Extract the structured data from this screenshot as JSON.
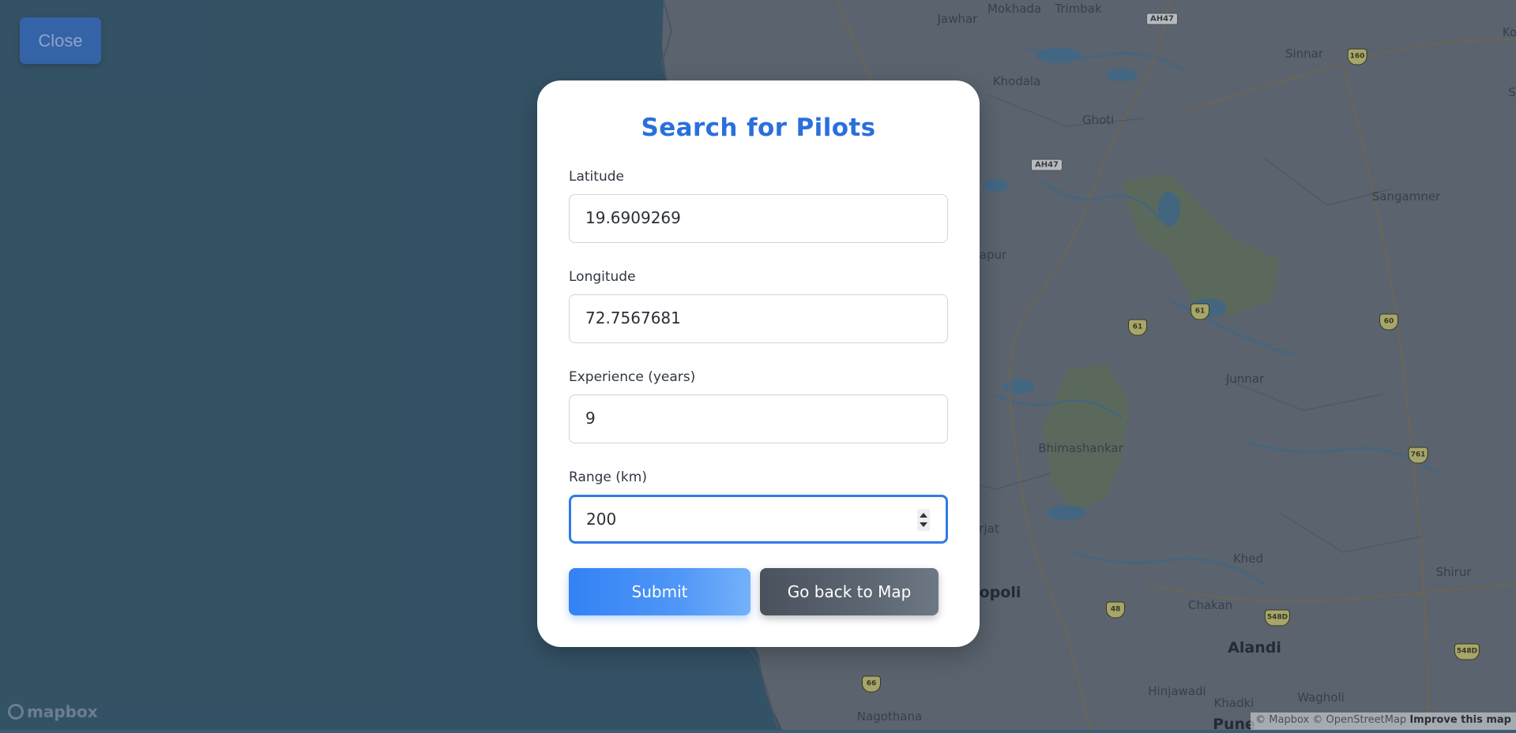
{
  "map": {
    "places": [
      {
        "name": "Jawhar",
        "big": false
      },
      {
        "name": "Mokhada",
        "big": false
      },
      {
        "name": "Trimbak",
        "big": false
      },
      {
        "name": "Khodala",
        "big": false
      },
      {
        "name": "Ghoti",
        "big": false
      },
      {
        "name": "Sinnar",
        "big": false
      },
      {
        "name": "Sangamner",
        "big": false
      },
      {
        "name": "Junnar",
        "big": false
      },
      {
        "name": "Bhimashankar",
        "big": false
      },
      {
        "name": "Khed",
        "big": false
      },
      {
        "name": "Chakan",
        "big": false
      },
      {
        "name": "Alandi",
        "big": true
      },
      {
        "name": "Shirur",
        "big": false
      },
      {
        "name": "Hinjawadi",
        "big": false
      },
      {
        "name": "Khadki",
        "big": false
      },
      {
        "name": "Wagholi",
        "big": false
      },
      {
        "name": "Nagothana",
        "big": false
      },
      {
        "name": "apur",
        "big": false
      },
      {
        "name": "rjat",
        "big": false
      },
      {
        "name": "opoli",
        "big": true
      },
      {
        "name": "Pune",
        "big": true
      },
      {
        "name": "Ko",
        "big": false
      },
      {
        "name": "S",
        "big": false
      }
    ],
    "shields": [
      {
        "label": "AH47",
        "flat": true
      },
      {
        "label": "AH47",
        "flat": true
      },
      {
        "label": "160",
        "flat": false
      },
      {
        "label": "61",
        "flat": false
      },
      {
        "label": "61",
        "flat": false
      },
      {
        "label": "60",
        "flat": false
      },
      {
        "label": "761",
        "flat": false
      },
      {
        "label": "48",
        "flat": false
      },
      {
        "label": "548D",
        "flat": false
      },
      {
        "label": "548D",
        "flat": false
      },
      {
        "label": "66",
        "flat": false
      }
    ]
  },
  "close_button": {
    "label": "Close"
  },
  "modal": {
    "title": "Search for Pilots",
    "fields": {
      "latitude": {
        "label": "Latitude",
        "value": "19.6909269"
      },
      "longitude": {
        "label": "Longitude",
        "value": "72.7567681"
      },
      "experience": {
        "label": "Experience (years)",
        "value": "9"
      },
      "range": {
        "label": "Range (km)",
        "value": "200"
      }
    },
    "submit_label": "Submit",
    "back_label": "Go back to Map"
  },
  "attribution": {
    "logo_text": "mapbox",
    "mapbox": "© Mapbox",
    "osm": "© OpenStreetMap",
    "improve": "Improve this map"
  },
  "colors": {
    "accent": "#2a6fdc",
    "submit": "#3b82f6",
    "back": "#4b5563",
    "sea": "#3a5f75",
    "land": "#6c7580"
  }
}
